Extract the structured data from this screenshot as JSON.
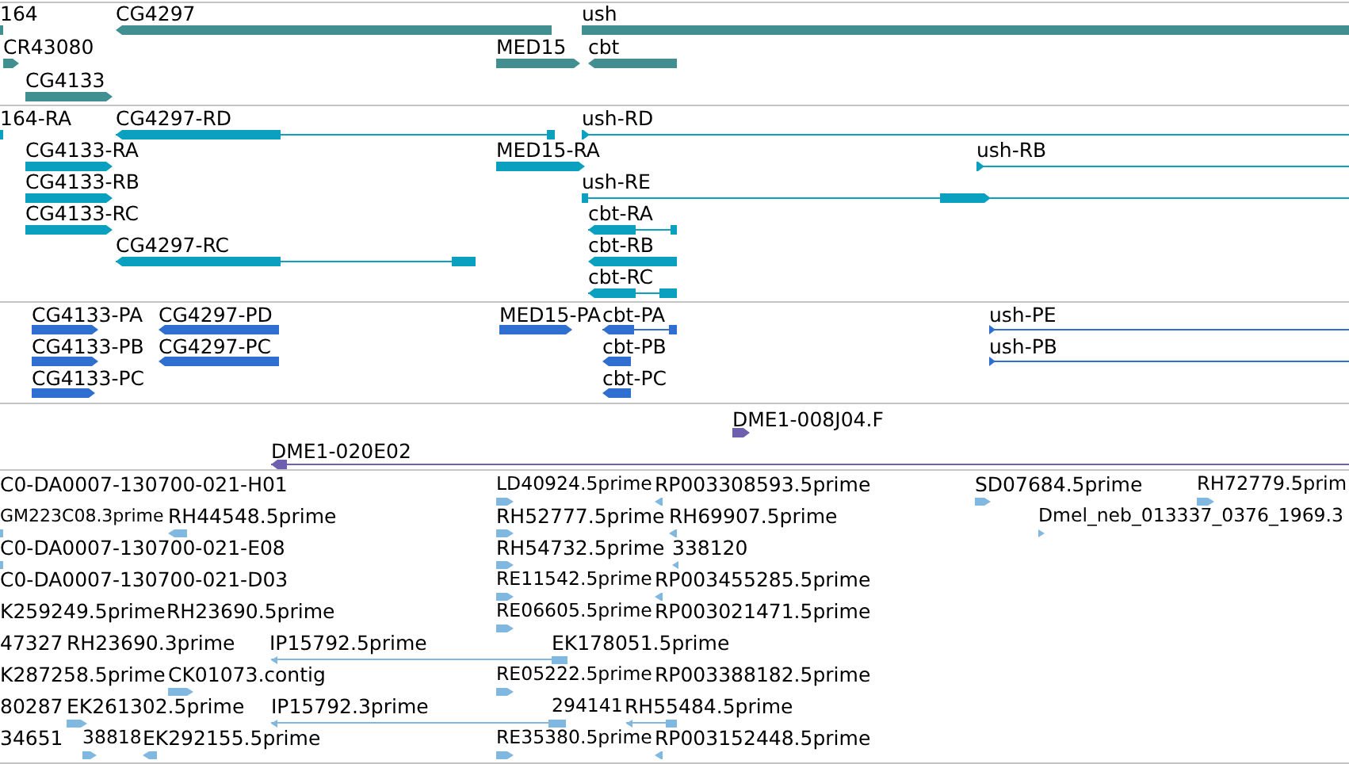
{
  "tracks": [
    {
      "kind": "gene",
      "features": [
        {
          "label": "164"
        },
        {
          "label": "CG4297",
          "reverse": true
        },
        {
          "label": "ush"
        },
        {
          "label": "CR43080",
          "reverse": false
        },
        {
          "label": "MED15",
          "reverse": false
        },
        {
          "label": "cbt",
          "reverse": true
        },
        {
          "label": "CG4133",
          "reverse": false
        }
      ]
    },
    {
      "kind": "transcript",
      "features": [
        {
          "label": "164-RA"
        },
        {
          "label": "CG4297-RD",
          "reverse": true
        },
        {
          "label": "ush-RD",
          "reverse": false
        },
        {
          "label": "CG4133-RA",
          "reverse": false
        },
        {
          "label": "MED15-RA",
          "reverse": false
        },
        {
          "label": "ush-RB",
          "reverse": false
        },
        {
          "label": "CG4133-RB",
          "reverse": false
        },
        {
          "label": "ush-RE",
          "reverse": false
        },
        {
          "label": "CG4133-RC",
          "reverse": false
        },
        {
          "label": "cbt-RA",
          "reverse": true
        },
        {
          "label": "CG4297-RC",
          "reverse": true
        },
        {
          "label": "cbt-RB",
          "reverse": true
        },
        {
          "label": "cbt-RC",
          "reverse": true
        }
      ]
    },
    {
      "kind": "protein",
      "features": [
        {
          "label": "CG4133-PA",
          "reverse": false
        },
        {
          "label": "CG4297-PD",
          "reverse": true
        },
        {
          "label": "MED15-PA",
          "reverse": false
        },
        {
          "label": "cbt-PA",
          "reverse": true
        },
        {
          "label": "ush-PE",
          "reverse": false
        },
        {
          "label": "CG4133-PB",
          "reverse": false
        },
        {
          "label": "CG4297-PC",
          "reverse": true
        },
        {
          "label": "cbt-PB",
          "reverse": true
        },
        {
          "label": "ush-PB",
          "reverse": false
        },
        {
          "label": "CG4133-PC",
          "reverse": false
        },
        {
          "label": "cbt-PC",
          "reverse": true
        }
      ]
    },
    {
      "kind": "clone",
      "features": [
        {
          "label": "DME1-008J04.F",
          "reverse": false
        },
        {
          "label": "DME1-020E02",
          "reverse": true
        }
      ]
    },
    {
      "kind": "est",
      "features": [
        {
          "label": "C0-DA0007-130700-021-H01"
        },
        {
          "label": "LD40924.5prime",
          "reverse": false
        },
        {
          "label": "RP003308593.5prime",
          "reverse": true
        },
        {
          "label": "SD07684.5prime",
          "reverse": false
        },
        {
          "label": "RH72779.5prim",
          "reverse": false
        },
        {
          "label": "GM223C08.3prime"
        },
        {
          "label": "RH44548.5prime",
          "reverse": true
        },
        {
          "label": "RH52777.5prime",
          "reverse": false
        },
        {
          "label": "RH69907.5prime",
          "reverse": true
        },
        {
          "label": "Dmel_neb_013337_0376_1969.3",
          "reverse": false
        },
        {
          "label": "C0-DA0007-130700-021-E08"
        },
        {
          "label": "RH54732.5prime",
          "reverse": false
        },
        {
          "label": "338120",
          "reverse": true
        },
        {
          "label": "C0-DA0007-130700-021-D03"
        },
        {
          "label": "RE11542.5prime",
          "reverse": false
        },
        {
          "label": "RP003455285.5prime",
          "reverse": true
        },
        {
          "label": "K259249.5prime"
        },
        {
          "label": "RH23690.5prime"
        },
        {
          "label": "RE06605.5prime",
          "reverse": false
        },
        {
          "label": "RP003021471.5prime"
        },
        {
          "label": "47327"
        },
        {
          "label": "RH23690.3prime"
        },
        {
          "label": "IP15792.5prime",
          "reverse": true
        },
        {
          "label": "EK178051.5prime"
        },
        {
          "label": "K287258.5prime"
        },
        {
          "label": "CK01073.contig",
          "reverse": false
        },
        {
          "label": "RE05222.5prime",
          "reverse": false
        },
        {
          "label": "RP003388182.5prime"
        },
        {
          "label": "80287"
        },
        {
          "label": "EK261302.5prime",
          "reverse": false
        },
        {
          "label": "IP15792.3prime",
          "reverse": true
        },
        {
          "label": "294141"
        },
        {
          "label": "RH55484.5prime",
          "reverse": true
        },
        {
          "label": "34651"
        },
        {
          "label": "38818",
          "reverse": false
        },
        {
          "label": "EK292155.5prime",
          "reverse": true
        },
        {
          "label": "RE35380.5prime",
          "reverse": false
        },
        {
          "label": "RP003152448.5prime",
          "reverse": true
        }
      ]
    }
  ]
}
